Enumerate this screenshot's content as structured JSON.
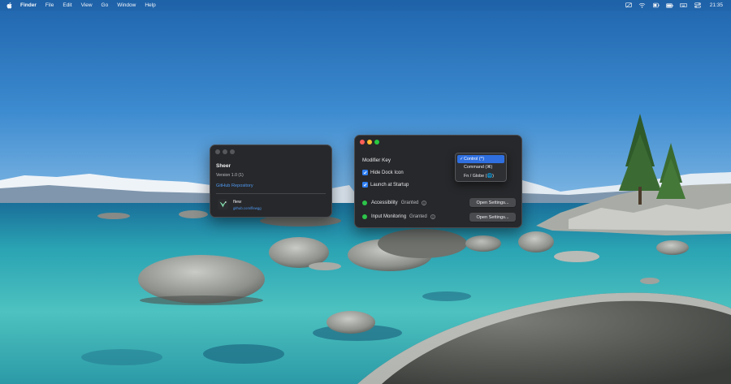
{
  "menubar": {
    "app_name": "Finder",
    "items": [
      "File",
      "Edit",
      "View",
      "Go",
      "Window",
      "Help"
    ],
    "status_icons": [
      "screen-mirror-icon",
      "wifi-icon",
      "bluetooth-icon",
      "battery-icon",
      "keyboard-icon",
      "control-center-icon"
    ],
    "clock": "21:35"
  },
  "about_window": {
    "app_name": "Sheer",
    "version": "Version 1.0 (1)",
    "repo_link": "GitHub Repository",
    "related_app": {
      "name": "flew",
      "url": "github.com/flewgg",
      "icon": "flew-app-icon"
    }
  },
  "settings_window": {
    "modifier_label": "Modifier Key",
    "hide_dock_icon": {
      "label": "Hide Dock Icon",
      "checked": true
    },
    "launch_at_startup": {
      "label": "Launch at Startup",
      "checked": true
    },
    "accessibility": {
      "label": "Accessibility",
      "status": "Granted",
      "button": "Open Settings...",
      "status_color": "#2cc44a"
    },
    "input_monitoring": {
      "label": "Input Monitoring",
      "status": "Granted",
      "button": "Open Settings...",
      "status_color": "#2cc44a"
    },
    "modifier_options": [
      "Control (^)",
      "Command (⌘)",
      "Fn / Globe (🌐)"
    ],
    "selected_option": "Control (^)"
  },
  "colors": {
    "accent": "#2f7ff2",
    "link": "#4f98ef",
    "window_bg": "#27282b",
    "close": "#fe5f57",
    "minimize": "#febc2e",
    "zoom": "#28c840"
  }
}
